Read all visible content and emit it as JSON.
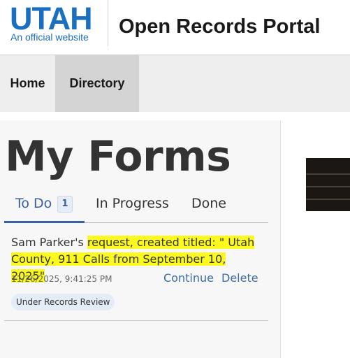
{
  "header": {
    "logo_word": "UTAH",
    "logo_sub": "An official website",
    "portal_title": "Open Records Portal",
    "brand_color": "#1b6fc0"
  },
  "nav": {
    "items": [
      {
        "label": "Home",
        "active": false
      },
      {
        "label": "Directory",
        "active": true
      }
    ]
  },
  "main": {
    "title": "My Forms",
    "tabs": [
      {
        "label": "To Do",
        "count": "1",
        "active": true
      },
      {
        "label": "In Progress",
        "active": false
      },
      {
        "label": "Done",
        "active": false
      }
    ],
    "items": [
      {
        "text_plain": "Sam Parker's ",
        "text_highlighted": "request, created titled: \" Utah County, 911 Calls from September 10, 2025\"",
        "date": "11/26/2025, 9:41:25 PM",
        "continue_label": "Continue",
        "delete_label": "Delete",
        "status": "Under Records Review"
      }
    ]
  },
  "colors": {
    "accent": "#3a5fa0",
    "highlight": "#fbf91e",
    "badge_bg": "#e4ecf8"
  }
}
